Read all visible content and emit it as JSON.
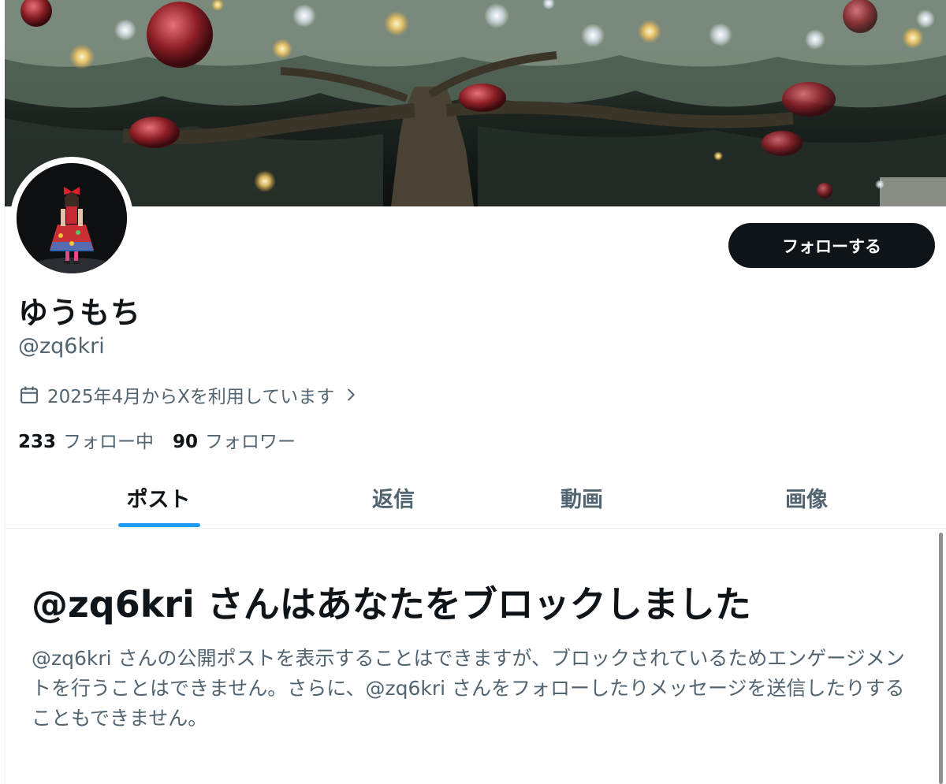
{
  "profile": {
    "display_name": "ゆうもち",
    "handle": "@zq6kri",
    "joined": "2025年4月からXを利用しています",
    "follow_button": "フォローする",
    "following_count": "233",
    "following_label": "フォロー中",
    "followers_count": "90",
    "followers_label": "フォロワー"
  },
  "tabs": [
    {
      "label": "ポスト",
      "active": true
    },
    {
      "label": "返信",
      "active": false
    },
    {
      "label": "動画",
      "active": false
    },
    {
      "label": "画像",
      "active": false
    }
  ],
  "blocked_notice": {
    "title": "@zq6kri さんはあなたをブロックしました",
    "description": "@zq6kri さんの公開ポストを表示することはできますが、ブロックされているためエンゲージメントを行うことはできません。さらに、@zq6kri さんをフォローしたりメッセージを送信したりすることもできません。"
  },
  "icons": {
    "joined": "calendar-icon",
    "joined_more": "chevron-right-icon"
  },
  "colors": {
    "text_primary": "#0f1419",
    "text_secondary": "#536471",
    "accent": "#1d9bf0",
    "follow_button_bg": "#0f1419"
  }
}
